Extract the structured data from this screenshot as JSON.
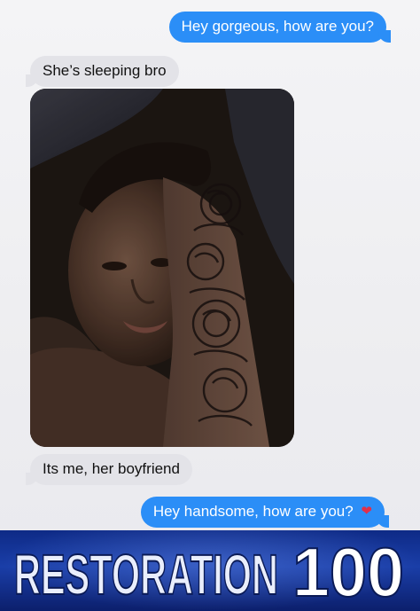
{
  "messages": [
    {
      "id": "msg1",
      "direction": "sent",
      "text": "Hey gorgeous, how are you?"
    },
    {
      "id": "msg2",
      "direction": "received",
      "text": "She’s sleeping bro"
    },
    {
      "id": "msg3",
      "direction": "received",
      "text": "Its me, her boyfriend"
    },
    {
      "id": "msg4",
      "direction": "sent",
      "text": "Hey handsome, how are you?",
      "emoji": "❤"
    }
  ],
  "photo": {
    "description_icon": "selfie-photo"
  },
  "banner": {
    "word": "RESTORATION",
    "number": "100"
  },
  "colors": {
    "sent_bubble": "#2b8ef7",
    "received_bubble": "#e3e3e8",
    "banner_bg": "#1a3ea8",
    "heart": "#e0304a"
  }
}
